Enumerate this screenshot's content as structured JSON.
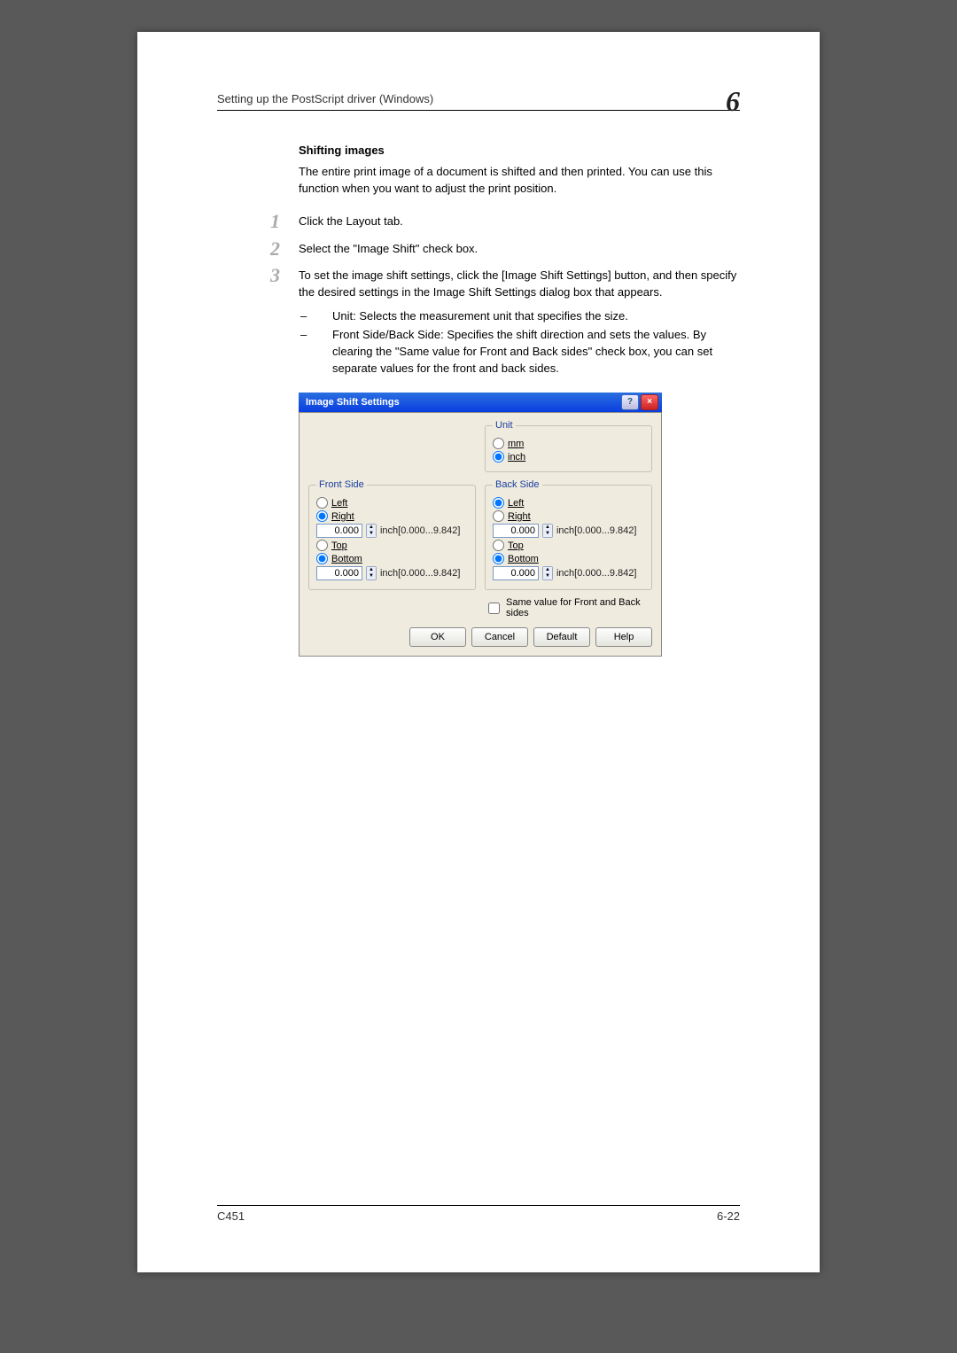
{
  "header": {
    "section": "Setting up the PostScript driver (Windows)",
    "chapter": "6"
  },
  "content": {
    "heading": "Shifting images",
    "intro": "The entire print image of a document is shifted and then printed. You can use this function when you want to adjust the print position.",
    "steps": {
      "s1": "Click the Layout tab.",
      "s2": "Select the \"Image Shift\" check box.",
      "s3": "To set the image shift settings, click the [Image Shift Settings] button, and then specify the desired settings in the Image Shift Settings dialog box that appears.",
      "b1": "Unit: Selects the measurement unit that specifies the size.",
      "b2": "Front Side/Back Side: Specifies the shift direction and sets the values. By clearing the \"Same value for Front and Back sides\" check box, you can set separate values for the front and back sides."
    }
  },
  "dlg": {
    "title": "Image Shift Settings",
    "help": "?",
    "close": "×",
    "unit": {
      "legend": "Unit",
      "mm": "mm",
      "inch": "inch"
    },
    "front": {
      "legend": "Front Side",
      "left": "Left",
      "right": "Right",
      "v1": "0.000",
      "r1": "inch[0.000...9.842]",
      "top": "Top",
      "bottom": "Bottom",
      "v2": "0.000",
      "r2": "inch[0.000...9.842]"
    },
    "back": {
      "legend": "Back Side",
      "left": "Left",
      "right": "Right",
      "v1": "0.000",
      "r1": "inch[0.000...9.842]",
      "top": "Top",
      "bottom": "Bottom",
      "v2": "0.000",
      "r2": "inch[0.000...9.842]"
    },
    "same": "Same value for Front and Back sides",
    "ok": "OK",
    "cancel": "Cancel",
    "default": "Default",
    "helpBtn": "Help"
  },
  "footer": {
    "model": "C451",
    "page": "6-22"
  }
}
